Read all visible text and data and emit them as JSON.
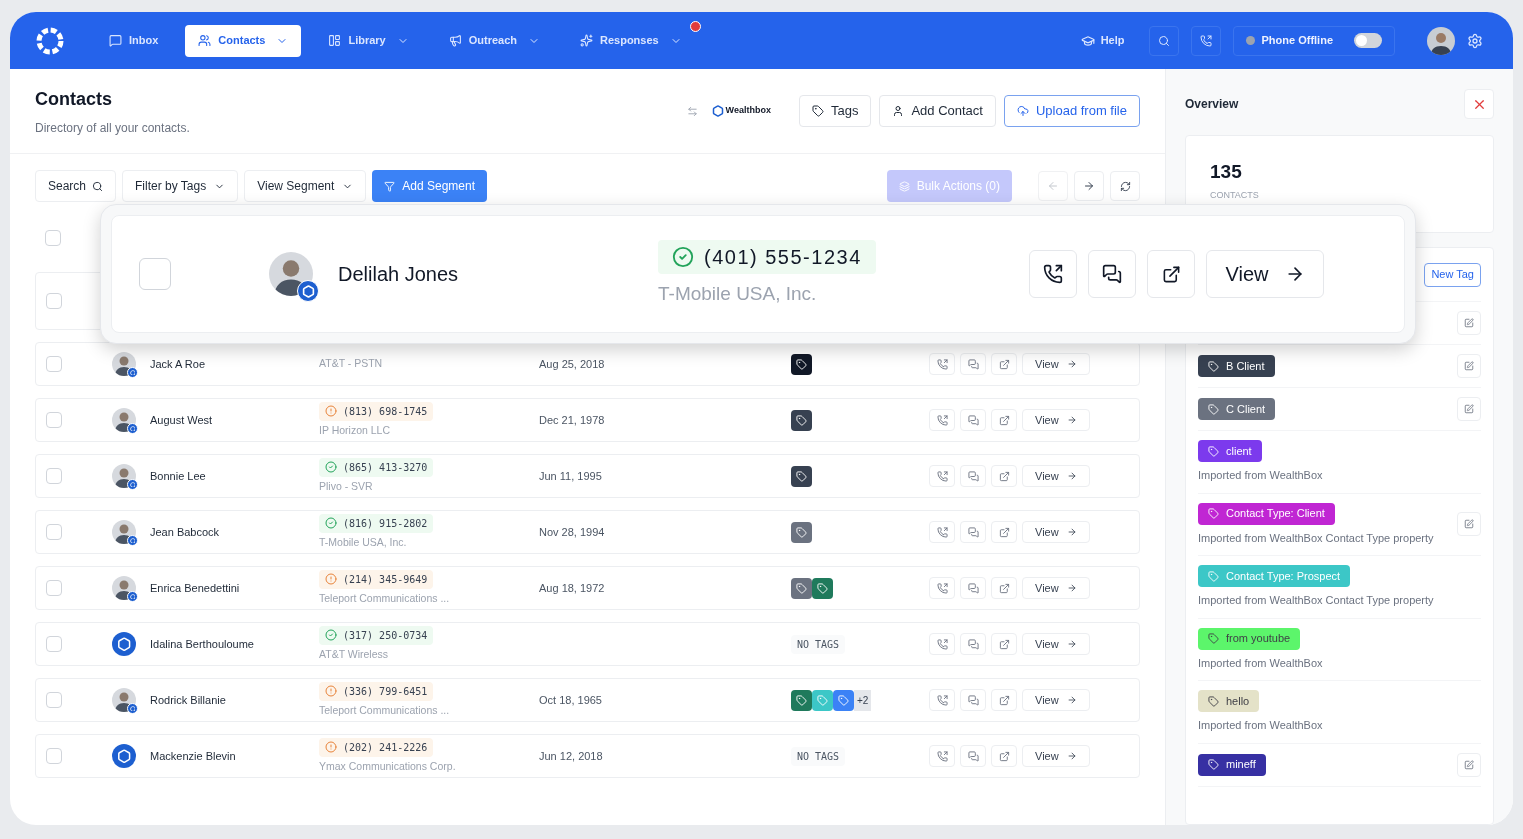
{
  "nav": {
    "items": [
      {
        "label": "Inbox",
        "selected": false,
        "dropdown": false,
        "notification": false
      },
      {
        "label": "Contacts",
        "selected": true,
        "dropdown": true,
        "notification": false
      },
      {
        "label": "Library",
        "selected": false,
        "dropdown": true,
        "notification": false
      },
      {
        "label": "Outreach",
        "selected": false,
        "dropdown": true,
        "notification": false
      },
      {
        "label": "Responses",
        "selected": false,
        "dropdown": true,
        "notification": true
      }
    ],
    "help": "Help",
    "phone_status": {
      "label": "Phone Offline",
      "on": false
    }
  },
  "page": {
    "title": "Contacts",
    "subtitle": "Directory of all your contacts.",
    "integration": "Wealthbox",
    "buttons": [
      {
        "label": "Tags",
        "kind": "tags"
      },
      {
        "label": "Add Contact",
        "kind": "add"
      },
      {
        "label": "Upload from file",
        "kind": "upload"
      }
    ]
  },
  "toolbar": {
    "search": "Search",
    "filter": "Filter by Tags",
    "segment": "View Segment",
    "add_segment": "Add Segment",
    "bulk": {
      "label": "Bulk Actions (0)",
      "disabled": true
    }
  },
  "table": {
    "select_all": {
      "checked": false
    },
    "covered_row": {
      "checked": false
    },
    "rows": [
      {
        "name": "Jack A Roe",
        "kind": "photo",
        "carrier": "AT&T - PSTN",
        "date": "Aug 25, 2018",
        "tags": [
          {
            "color": "#111827"
          }
        ],
        "checked": false,
        "action": "View"
      },
      {
        "name": "August West",
        "kind": "photo",
        "phone": "(813) 698-1745",
        "carrier": "IP Horizon LLC",
        "verified": false,
        "date": "Dec 21, 1978",
        "tags": [
          {
            "color": "#374151"
          }
        ],
        "checked": false,
        "action": "View"
      },
      {
        "name": "Bonnie Lee",
        "kind": "photo",
        "phone": "(865) 413-3270",
        "carrier": "Plivo - SVR",
        "verified": true,
        "date": "Jun 11, 1995",
        "tags": [
          {
            "color": "#374151"
          }
        ],
        "checked": false,
        "action": "View"
      },
      {
        "name": "Jean Babcock",
        "kind": "photo",
        "phone": "(816) 915-2802",
        "carrier": "T-Mobile USA, Inc.",
        "verified": true,
        "date": "Nov 28, 1994",
        "tags": [
          {
            "color": "#6b7280"
          }
        ],
        "checked": false,
        "action": "View"
      },
      {
        "name": "Enrica Benedettini",
        "kind": "photo",
        "phone": "(214) 345-9649",
        "carrier": "Teleport Communications ...",
        "verified": false,
        "date": "Aug 18, 1972",
        "tags": [
          {
            "color": "#6b7280"
          },
          {
            "color": "#1f7a5c"
          }
        ],
        "checked": false,
        "action": "View"
      },
      {
        "name": "Idalina Berthouloume",
        "kind": "wealthbox",
        "phone": "(317) 250-0734",
        "carrier": "AT&T Wireless",
        "verified": true,
        "no_tags": "NO TAGS",
        "checked": false,
        "action": "View"
      },
      {
        "name": "Rodrick Billanie",
        "kind": "photo",
        "phone": "(336) 799-6451",
        "carrier": "Teleport Communications ...",
        "verified": false,
        "date": "Oct 18, 1965",
        "tags": [
          {
            "color": "#1f7a5c"
          },
          {
            "color": "#3cc7c7"
          },
          {
            "color": "#3b82f6"
          }
        ],
        "more": "+2",
        "checked": false,
        "action": "View"
      },
      {
        "name": "Mackenzie Blevin",
        "kind": "wealthbox",
        "phone": "(202) 241-2226",
        "carrier": "Ymax Communications Corp.",
        "verified": false,
        "date": "Jun 12, 2018",
        "no_tags": "NO TAGS",
        "checked": false,
        "action": "View"
      }
    ]
  },
  "highlight": {
    "name": "Delilah Jones",
    "kind": "photo",
    "phone": "(401) 555-1234",
    "carrier": "T-Mobile USA, Inc.",
    "verified": true,
    "checked": false,
    "action": "View"
  },
  "overview": {
    "title": "Overview",
    "stat": {
      "value": "135",
      "label": "CONTACTS"
    },
    "new_tag": "New Tag",
    "tags": [
      {
        "editable": true
      },
      {
        "label": "B Client",
        "color": "#374151",
        "editable": true
      },
      {
        "label": "C Client",
        "color": "#6b7280",
        "editable": true
      },
      {
        "label": "client",
        "color": "#7c3aed",
        "note": "Imported from WealthBox",
        "editable": false
      },
      {
        "label": "Contact Type: Client",
        "color": "#c026d3",
        "note": "Imported from WealthBox Contact Type property",
        "editable": true
      },
      {
        "label": "Contact Type: Prospect",
        "color": "#3cc7c7",
        "note": "Imported from WealthBox Contact Type property",
        "editable": false
      },
      {
        "label": "from youtube",
        "color": "#5cf56b",
        "note": "Imported from WealthBox",
        "editable": false
      },
      {
        "label": "hello",
        "color": "#e4e2c8",
        "note": "Imported from WealthBox",
        "editable": false
      },
      {
        "label": "mineff",
        "color": "#3730a3",
        "editable": true
      }
    ]
  }
}
